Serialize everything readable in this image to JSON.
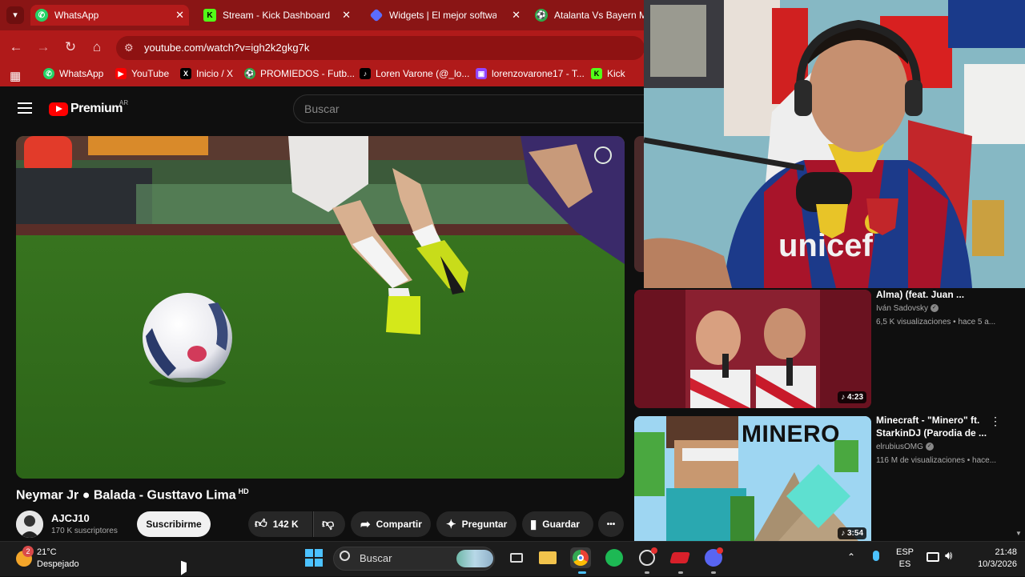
{
  "browser": {
    "tabs": [
      {
        "title": "WhatsApp",
        "icon": "whatsapp-icon",
        "color": "#25d366"
      },
      {
        "title": "Stream - Kick Dashboard",
        "icon": "kick-icon",
        "color": "#53fc18"
      },
      {
        "title": "Widgets | El mejor software",
        "icon": "widgets-icon",
        "color": "#5b6cff"
      },
      {
        "title": "Atalanta Vs Bayern Mu",
        "icon": "soccer-icon",
        "color": "#2eaa4a"
      }
    ],
    "tab_close": "✕",
    "url": "youtube.com/watch?v=igh2k2gkg7k",
    "bookmarks": [
      {
        "label": "WhatsApp",
        "icon": "whatsapp-icon",
        "color": "#25d366"
      },
      {
        "label": "YouTube",
        "icon": "youtube-icon",
        "color": "#ff0000"
      },
      {
        "label": "Inicio / X",
        "icon": "x-icon",
        "color": "#000000"
      },
      {
        "label": "PROMIEDOS - Futb...",
        "icon": "promiedos-icon",
        "color": "#2eaa4a"
      },
      {
        "label": "Loren Varone (@_lo...",
        "icon": "tiktok-icon",
        "color": "#000000"
      },
      {
        "label": "lorenzovarone17 - T...",
        "icon": "twitch-icon",
        "color": "#9146ff"
      },
      {
        "label": "Kick",
        "icon": "kick-icon",
        "color": "#53fc18"
      }
    ]
  },
  "youtube": {
    "logo_text": "Premium",
    "region": "AR",
    "search_placeholder": "Buscar",
    "video": {
      "title": "Neymar Jr ● Balada - Gusttavo Lima",
      "badge": "HD",
      "channel": "AJCJ10",
      "subscribers": "170 K suscriptores",
      "subscribe_label": "Suscribirme",
      "likes": "142 K",
      "share_label": "Compartir",
      "ask_label": "Preguntar",
      "save_label": "Guardar",
      "more_label": "•••"
    },
    "recommendations": [
      {
        "title": "Alma) (feat. Juan ...",
        "channel": "Iván Sadovsky",
        "meta": "6,5 K visualizaciones • hace 5 a...",
        "duration": "4:23"
      },
      {
        "title_line1": "Minecraft - \"Minero\" ft.",
        "title_line2": "StarkinDJ (Parodia de ...",
        "channel": "elrubiusOMG",
        "meta": "116 M de visualizaciones • hace...",
        "duration": "3:54",
        "thumb_text": "MINERO"
      }
    ]
  },
  "taskbar": {
    "weather_temp": "21°C",
    "weather_desc": "Despejado",
    "weather_badge": "2",
    "search_placeholder": "Buscar",
    "language": "ESP",
    "region": "ES",
    "time": "21:48",
    "date": "10/3/2026"
  }
}
